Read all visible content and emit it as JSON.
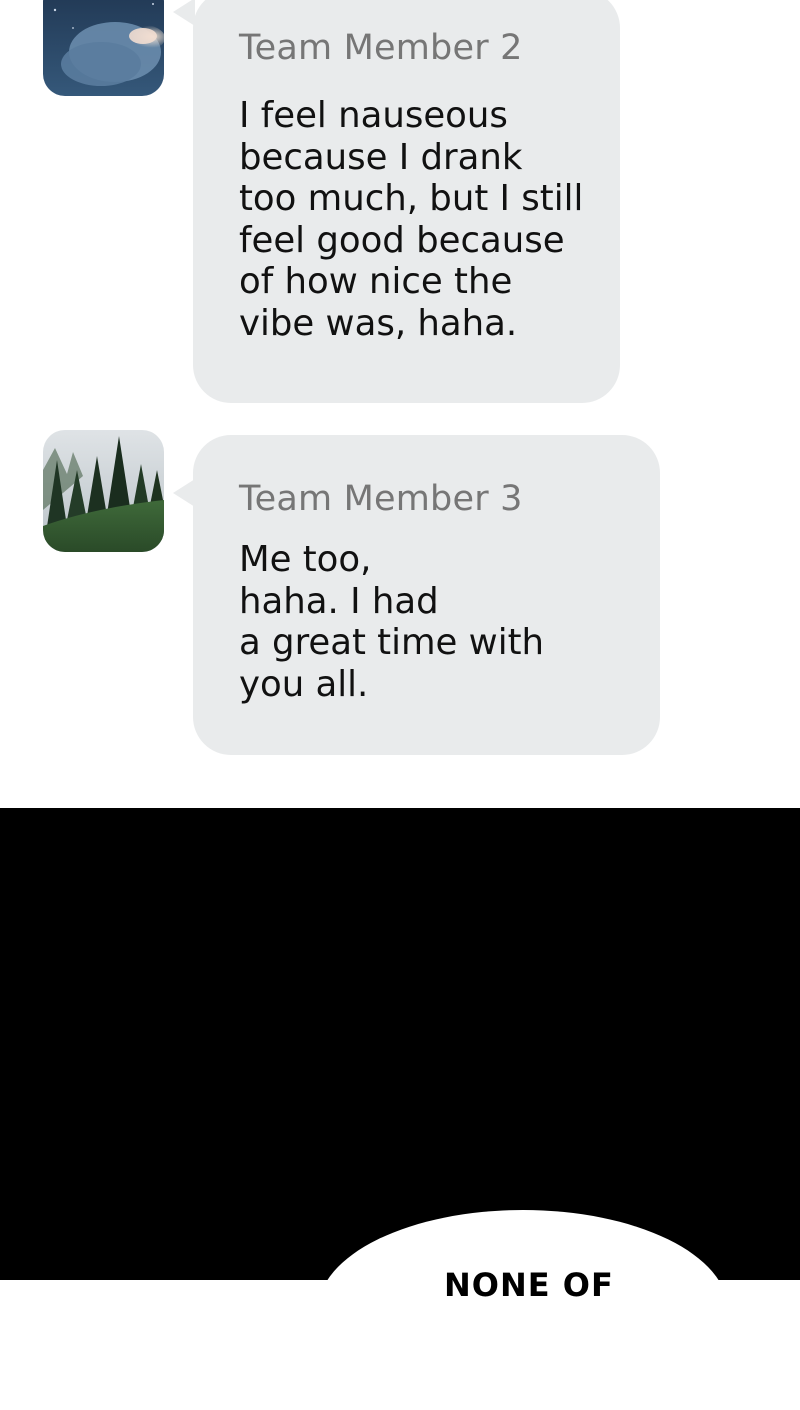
{
  "messages": [
    {
      "sender": "Team Member 2",
      "avatar_icon": "night-cloud-avatar-icon",
      "lines": [
        "I feel nauseous",
        "because I drank",
        "too much, but I still",
        "feel good because",
        "of how nice the",
        "vibe was, haha."
      ]
    },
    {
      "sender": "Team Member 3",
      "avatar_icon": "forest-avatar-icon",
      "lines": [
        "Me too,",
        "haha. I had",
        "a great time with",
        "you all."
      ]
    }
  ],
  "speech_bubble": {
    "text": "NONE OF"
  },
  "colors": {
    "bubble": "#e9ebec",
    "sender": "#767676",
    "panel": "#000000"
  }
}
